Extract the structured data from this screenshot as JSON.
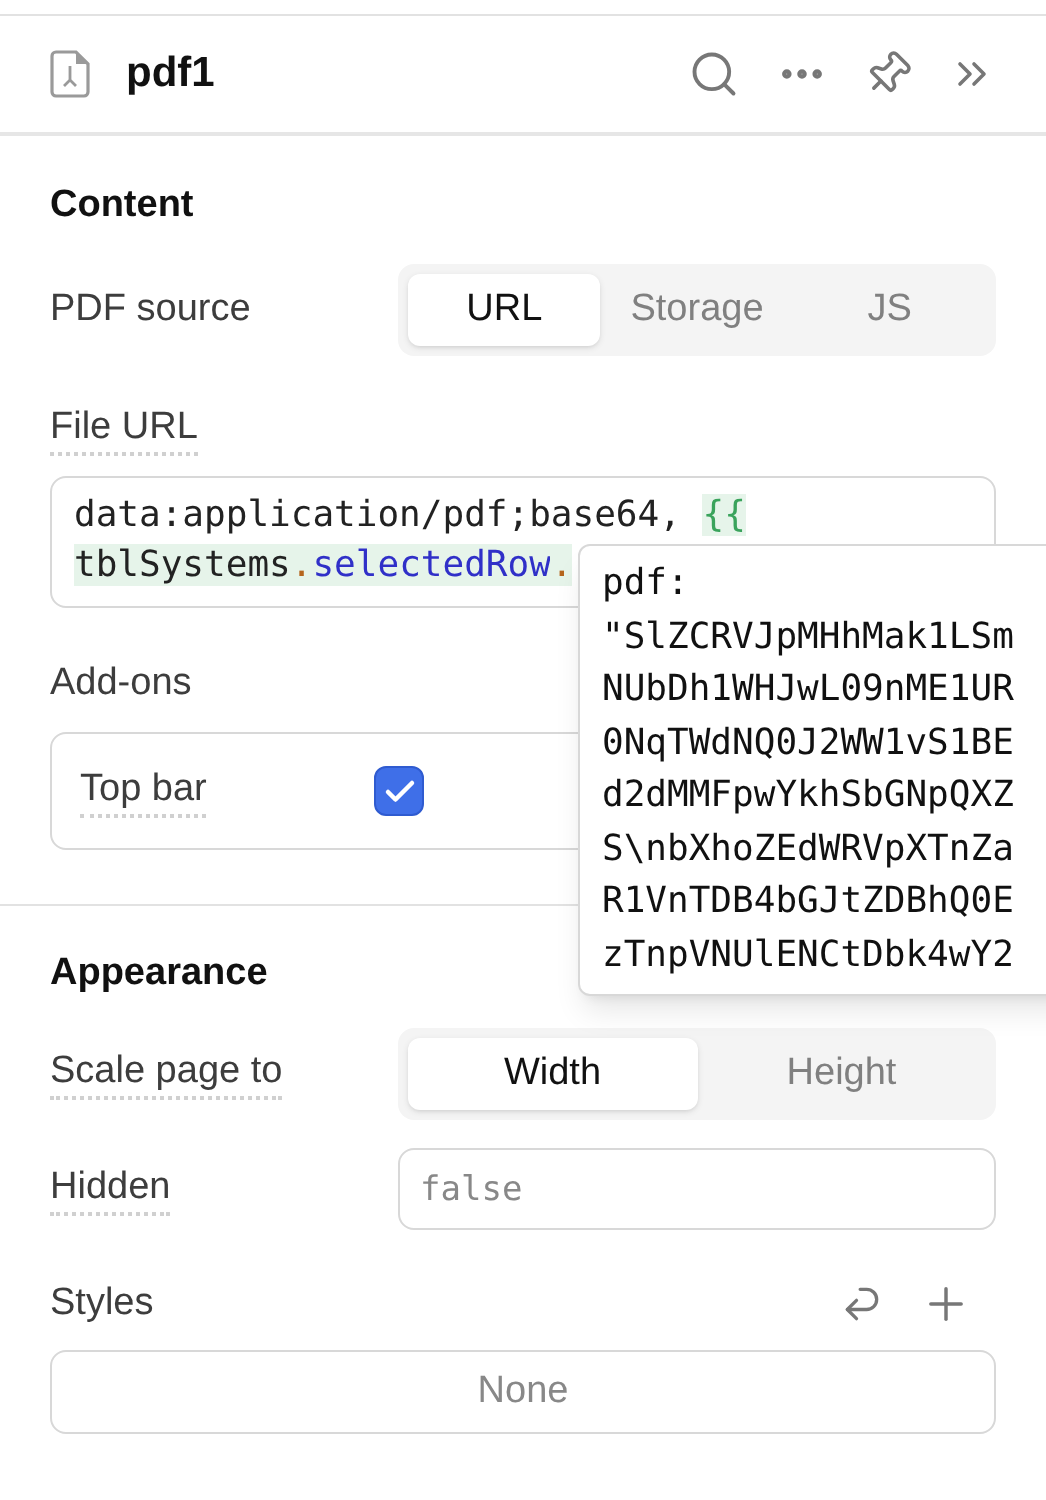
{
  "header": {
    "title": "pdf1"
  },
  "content": {
    "title": "Content",
    "pdf_source": {
      "label": "PDF source",
      "has_tooltip": false,
      "options": [
        {
          "label": "URL",
          "selected": true
        },
        {
          "label": "Storage",
          "selected": false
        },
        {
          "label": "JS",
          "selected": false
        }
      ]
    },
    "file_url": {
      "label": "File URL",
      "has_tooltip": true,
      "tokens": [
        {
          "kind": "plain",
          "text": "data:application/pdf;base64, "
        },
        {
          "kind": "brace",
          "text": "{{",
          "line_end": true
        },
        {
          "kind": "identifier",
          "text": "tblSystems"
        },
        {
          "kind": "dot",
          "text": "."
        },
        {
          "kind": "property",
          "text": "selectedRow"
        },
        {
          "kind": "dot",
          "text": "."
        }
      ]
    },
    "addons": {
      "label": "Add-ons",
      "has_tooltip": false,
      "items": [
        {
          "label": "Top bar",
          "has_tooltip": true,
          "checked": true
        }
      ]
    }
  },
  "autocomplete_popup": {
    "lines": [
      "pdf:",
      "\"SlZCRVJpMHhMak1LSm",
      "NUbDh1WHJwL09nME1UR",
      "0NqTWdNQ0J2WW1vS1BE",
      "d2dMMFpwYkhSbGNpQXZ",
      "S\\nbXhoZEdWRVpXTnZa",
      "R1VnTDB4bGJtZDBhQ0E",
      "zTnpVNUlENCtDbk4wY2"
    ]
  },
  "appearance": {
    "title": "Appearance",
    "scale": {
      "label": "Scale page to",
      "has_tooltip": true,
      "options": [
        {
          "label": "Width",
          "selected": true
        },
        {
          "label": "Height",
          "selected": false
        }
      ]
    },
    "hidden": {
      "label": "Hidden",
      "has_tooltip": true,
      "placeholder": "false"
    },
    "styles": {
      "label": "Styles",
      "has_tooltip": false,
      "value": "None"
    }
  }
}
